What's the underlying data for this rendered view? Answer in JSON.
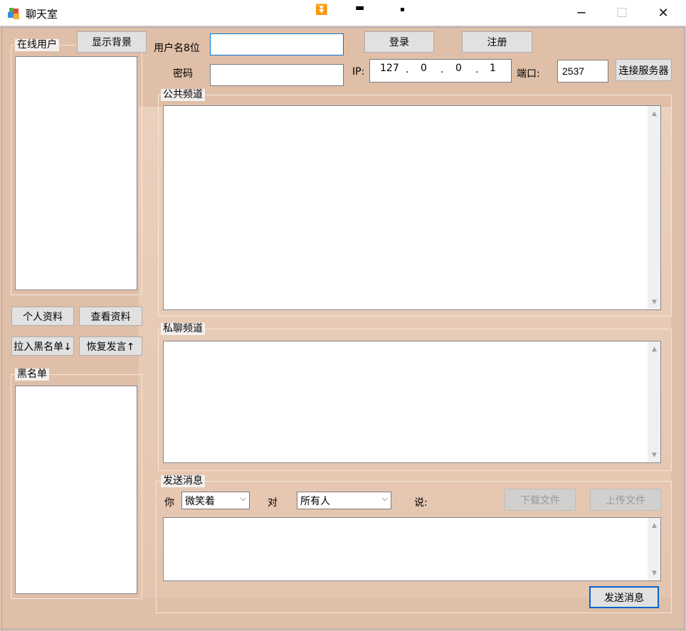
{
  "window": {
    "title": "聊天室",
    "minimize_glyph": "─",
    "maximize_glyph": "☐",
    "close_glyph": "✕",
    "extra_glyphs": [
      "⏬",
      "▬",
      "▪"
    ]
  },
  "left": {
    "online_users_label": "在线用户",
    "show_background_button": "显示背景",
    "profile_button": "个人资料",
    "view_profile_button": "查看资料",
    "blacklist_add_button": "拉入黑名单↓",
    "restore_speech_button": "恢复发言↑",
    "blacklist_label": "黑名单"
  },
  "login": {
    "username_label": "用户名8位",
    "username_value": "",
    "password_label": "密码",
    "password_value": "",
    "login_button": "登录",
    "register_button": "注册",
    "ip_label": "IP:",
    "ip_parts": [
      "127",
      "0",
      "0",
      "1"
    ],
    "ip_dot": ".",
    "port_label": "端口:",
    "port_value": "2537",
    "connect_button": "连接服务器"
  },
  "channels": {
    "public_label": "公共频道",
    "private_label": "私聊频道"
  },
  "send": {
    "group_label": "发送消息",
    "you_label": "你",
    "expression_value": "微笑着",
    "to_label": "对",
    "target_value": "所有人",
    "say_label": "说:",
    "download_button": "下载文件",
    "upload_button": "上传文件",
    "send_button": "发送消息"
  },
  "colors": {
    "client_bg": "#e0bfa8",
    "focus_border": "#0a64c8"
  }
}
